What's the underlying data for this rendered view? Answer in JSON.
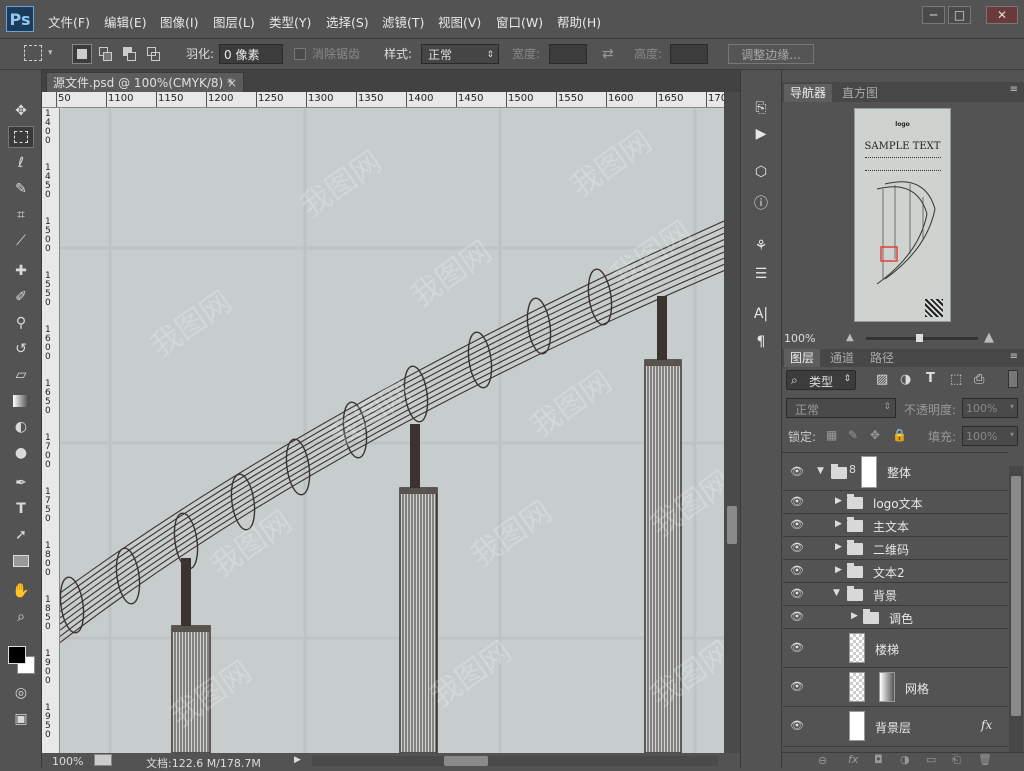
{
  "app": {
    "logo": "Ps"
  },
  "menu": [
    "文件(F)",
    "编辑(E)",
    "图像(I)",
    "图层(L)",
    "类型(Y)",
    "选择(S)",
    "滤镜(T)",
    "视图(V)",
    "窗口(W)",
    "帮助(H)"
  ],
  "window_controls": {
    "minimize": "─",
    "maximize": "□",
    "close": "✕"
  },
  "options": {
    "feather_label": "羽化:",
    "feather_value": "0 像素",
    "antialias_label": "消除锯齿",
    "style_label": "样式:",
    "style_value": "正常",
    "width_label": "宽度:",
    "height_label": "高度:",
    "refine_edge_button": "调整边缘..."
  },
  "document": {
    "tab_title": "源文件.psd @ 100%(CMYK/8) *",
    "close": "×"
  },
  "ruler": {
    "h_labels": [
      "50",
      "1100",
      "1150",
      "1200",
      "1250",
      "1300",
      "1350",
      "1400",
      "1450",
      "1500",
      "1550",
      "1600",
      "1650",
      "1700"
    ],
    "v_labels": [
      "1400",
      "1450",
      "1500",
      "1550",
      "1600",
      "1650",
      "1700",
      "1750",
      "1800",
      "1850",
      "1900",
      "1950"
    ]
  },
  "status": {
    "zoom": "100%",
    "doc_info": "文档:122.6 M/178.7M"
  },
  "navigator": {
    "tabs": [
      "导航器",
      "直方图"
    ],
    "zoom": "100%",
    "thumb_logo": "logo",
    "thumb_title": "SAMPLE TEXT"
  },
  "layers_panel": {
    "tabs": [
      "图层",
      "通道",
      "路径"
    ],
    "filter_label": "类型",
    "blend_mode": "正常",
    "opacity_label": "不透明度:",
    "opacity_value": "100%",
    "lock_label": "锁定:",
    "fill_label": "填充:",
    "fill_value": "100%",
    "layers": [
      {
        "name": "整体",
        "type": "group",
        "expanded": true
      },
      {
        "name": "logo文本",
        "type": "group",
        "expanded": false
      },
      {
        "name": "主文本",
        "type": "group",
        "expanded": false
      },
      {
        "name": "二维码",
        "type": "group",
        "expanded": false
      },
      {
        "name": "文本2",
        "type": "group",
        "expanded": false
      },
      {
        "name": "背景",
        "type": "group",
        "expanded": true
      },
      {
        "name": "调色",
        "type": "group",
        "expanded": false
      },
      {
        "name": "楼梯",
        "type": "pixel"
      },
      {
        "name": "网格",
        "type": "masked"
      },
      {
        "name": "背景层",
        "type": "pixel",
        "fx": "fx"
      }
    ]
  },
  "watermark": "我图网",
  "colors": {
    "canvas": "#c6cdcc",
    "panel": "#535353",
    "dark": "#3c3c3c",
    "accent_red": "#e8403a",
    "stair_ink": "#3a3330"
  }
}
